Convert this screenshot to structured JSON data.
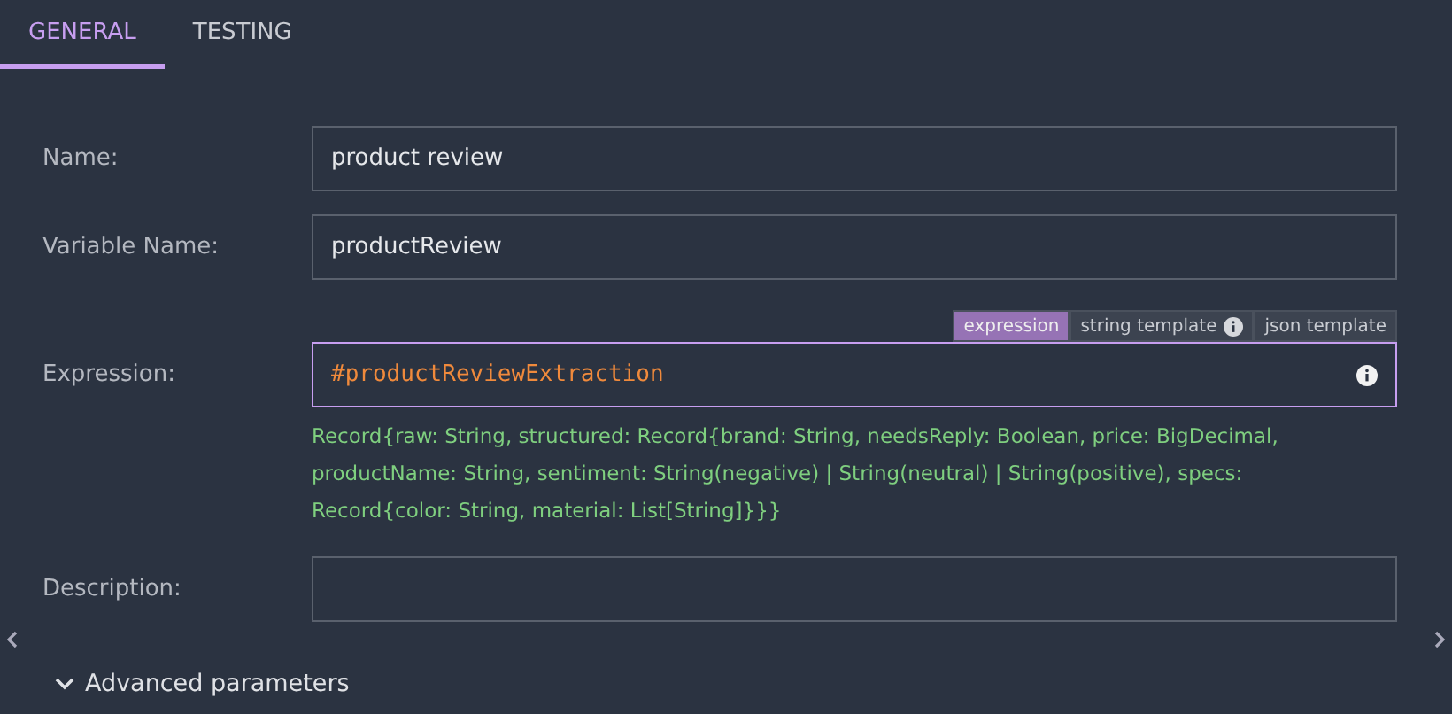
{
  "tabs": [
    {
      "label": "GENERAL",
      "selected": true
    },
    {
      "label": "TESTING",
      "selected": false
    }
  ],
  "fields": [
    {
      "label": "Name:",
      "value": "product review"
    },
    {
      "label": "Variable Name:",
      "value": "productReview"
    }
  ],
  "expression": {
    "label": "Expression:",
    "modes": [
      {
        "label": "expression",
        "selected": true,
        "info": false
      },
      {
        "label": "string template",
        "selected": false,
        "info": true
      },
      {
        "label": "json template",
        "selected": false,
        "info": false
      }
    ],
    "value": "#productReviewExtraction",
    "type_hint": "Record{raw: String, structured: Record{brand: String, needsReply: Boolean, price: BigDecimal, productName: String, sentiment: String(negative) | String(neutral) | String(positive), specs: Record{color: String, material: List[String]}}}"
  },
  "description": {
    "label": "Description:"
  },
  "advanced": {
    "label": "Advanced parameters",
    "expanded": false
  }
}
